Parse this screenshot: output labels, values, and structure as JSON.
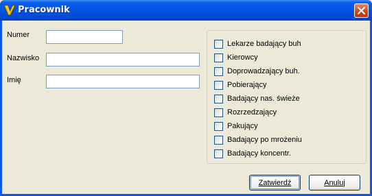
{
  "window": {
    "title": "Pracownik",
    "icon": "app-v-icon",
    "close_icon": "close-icon"
  },
  "form": {
    "numer": {
      "label": "Numer",
      "value": ""
    },
    "nazwisko": {
      "label": "Nazwisko",
      "value": ""
    },
    "imie": {
      "label": "Imię",
      "value": ""
    }
  },
  "roles": [
    {
      "label": "Lekarze badający buh",
      "checked": false
    },
    {
      "label": "Kierowcy",
      "checked": false
    },
    {
      "label": "Doprowadzający buh.",
      "checked": false
    },
    {
      "label": "Pobierający",
      "checked": false
    },
    {
      "label": "Badający nas. świeże",
      "checked": false
    },
    {
      "label": "Rozrzedzający",
      "checked": false
    },
    {
      "label": "Pakujący",
      "checked": false
    },
    {
      "label": "Badający po mrożeniu",
      "checked": false
    },
    {
      "label": "Badający koncentr.",
      "checked": false
    }
  ],
  "buttons": {
    "confirm": "Zatwierdź",
    "cancel": "Anuluj"
  },
  "colors": {
    "titlebar": "#0054e3",
    "face": "#ece9d8",
    "close": "#d2421a"
  }
}
